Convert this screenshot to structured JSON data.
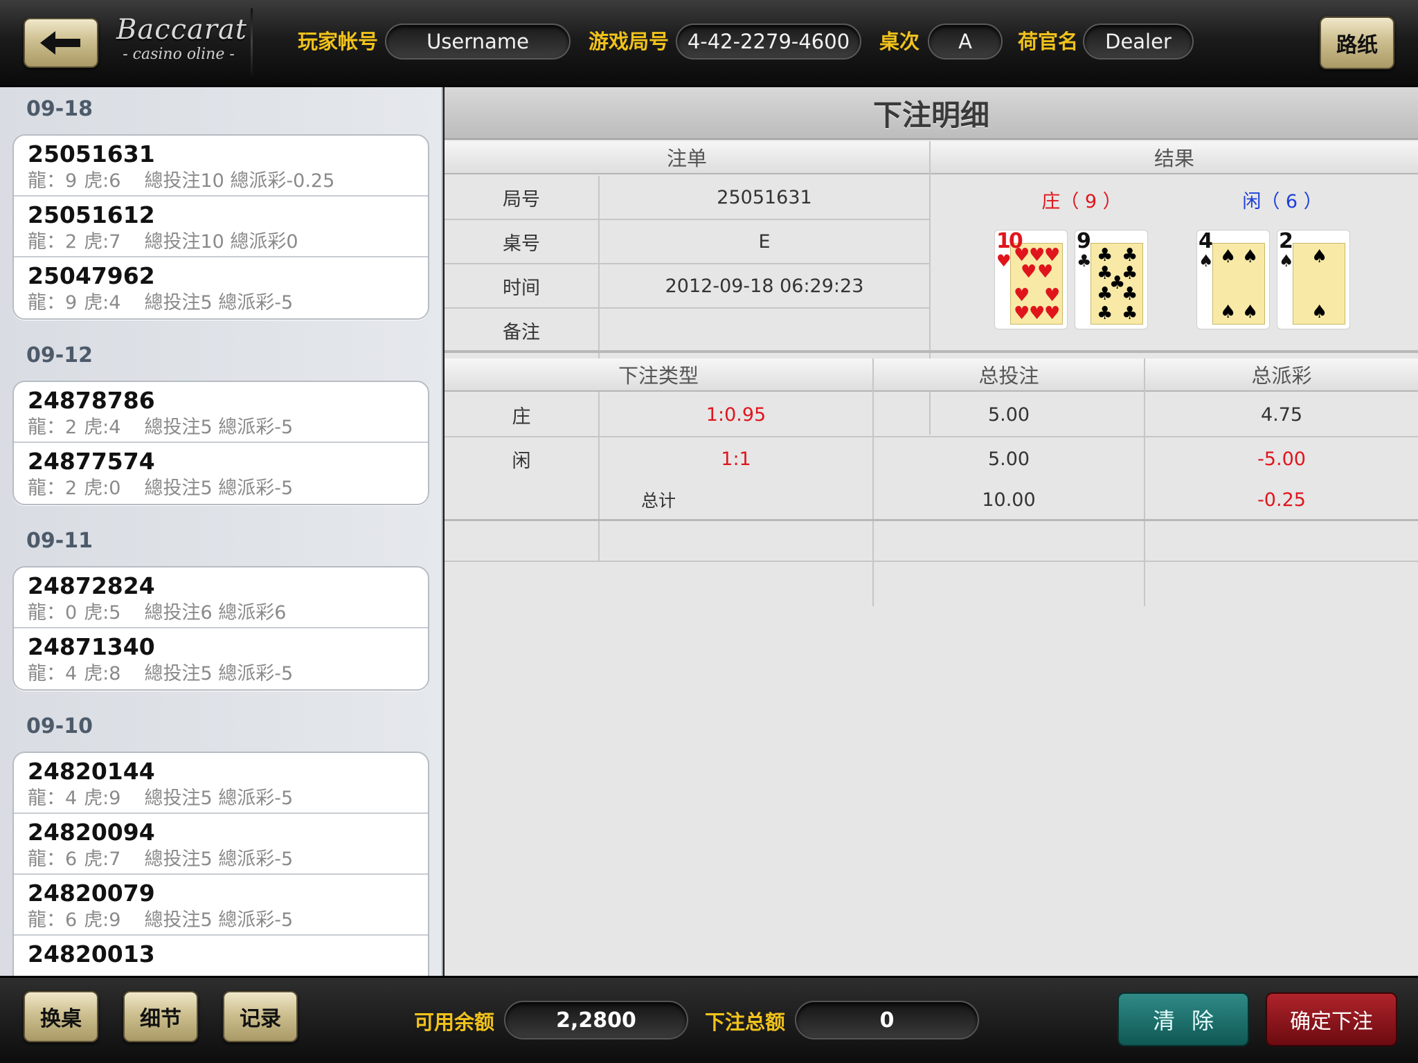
{
  "app": {
    "logo_title": "Baccarat",
    "logo_subtitle": "- casino oline -"
  },
  "topbar": {
    "player_label": "玩家帐号",
    "player_value": "Username",
    "round_label": "游戏局号",
    "round_value": "4-42-2279-4600",
    "table_label": "桌次",
    "table_value": "A",
    "dealer_label": "荷官名",
    "dealer_value": "Dealer",
    "road_map_button": "路纸"
  },
  "history": [
    {
      "date": "09-18",
      "items": [
        {
          "id": "25051631",
          "dragon": "龍：9",
          "tiger": "虎:6",
          "summary": "總投注10 總派彩-0.25"
        },
        {
          "id": "25051612",
          "dragon": "龍：2",
          "tiger": "虎:7",
          "summary": "總投注10 總派彩0"
        },
        {
          "id": "25047962",
          "dragon": "龍：9",
          "tiger": "虎:4",
          "summary": "總投注5 總派彩-5"
        }
      ]
    },
    {
      "date": "09-12",
      "items": [
        {
          "id": "24878786",
          "dragon": "龍：2",
          "tiger": "虎:4",
          "summary": "總投注5 總派彩-5"
        },
        {
          "id": "24877574",
          "dragon": "龍：2",
          "tiger": "虎:0",
          "summary": "總投注5 總派彩-5"
        }
      ]
    },
    {
      "date": "09-11",
      "items": [
        {
          "id": "24872824",
          "dragon": "龍：0",
          "tiger": "虎:5",
          "summary": "總投注6 總派彩6"
        },
        {
          "id": "24871340",
          "dragon": "龍：4",
          "tiger": "虎:8",
          "summary": "總投注5 總派彩-5"
        }
      ]
    },
    {
      "date": "09-10",
      "items": [
        {
          "id": "24820144",
          "dragon": "龍：4",
          "tiger": "虎:9",
          "summary": "總投注5 總派彩-5"
        },
        {
          "id": "24820094",
          "dragon": "龍：6",
          "tiger": "虎:7",
          "summary": "總投注5 總派彩-5"
        },
        {
          "id": "24820079",
          "dragon": "龍：6",
          "tiger": "虎:9",
          "summary": "總投注5 總派彩-5"
        },
        {
          "id": "24820013",
          "dragon": "",
          "tiger": "",
          "summary": ""
        }
      ]
    }
  ],
  "detail": {
    "title": "下注明细",
    "order_header": "注单",
    "result_header": "结果",
    "fields": [
      {
        "label": "局号",
        "value": "25051631"
      },
      {
        "label": "桌号",
        "value": "E"
      },
      {
        "label": "时间",
        "value": "2012-09-18  06:29:23"
      },
      {
        "label": "备注",
        "value": ""
      }
    ],
    "banker_label": "庄（ 9 ）",
    "player_label": "闲（ 6 ）",
    "banker_cards": [
      {
        "rank": "10",
        "suit": "♥",
        "color": "#e0151c"
      },
      {
        "rank": "9",
        "suit": "♣",
        "color": "#111111"
      }
    ],
    "player_cards": [
      {
        "rank": "4",
        "suit": "♠",
        "color": "#111111"
      },
      {
        "rank": "2",
        "suit": "♠",
        "color": "#111111"
      }
    ],
    "bets_header": {
      "type": "下注类型",
      "total_bet": "总投注",
      "total_payout": "总派彩"
    },
    "bets": [
      {
        "type": "庄",
        "odds": "1:0.95",
        "bet": "5.00",
        "payout": "4.75"
      },
      {
        "type": "闲",
        "odds": "1:1",
        "bet": "5.00",
        "payout": "-5.00"
      }
    ],
    "total": {
      "label": "总计",
      "bet": "10.00",
      "payout": "-0.25"
    },
    "colors": {
      "negative": "#e0151c",
      "banker": "#e0151c",
      "player": "#1d3fd8",
      "accent_gold": "#f1c21b"
    }
  },
  "bottombar": {
    "change_table": "换桌",
    "details": "细节",
    "records": "记录",
    "balance_label": "可用余额",
    "balance_value": "2,2800",
    "bet_total_label": "下注总额",
    "bet_total_value": "0",
    "clear_button": "清除",
    "confirm_button": "确定下注"
  }
}
